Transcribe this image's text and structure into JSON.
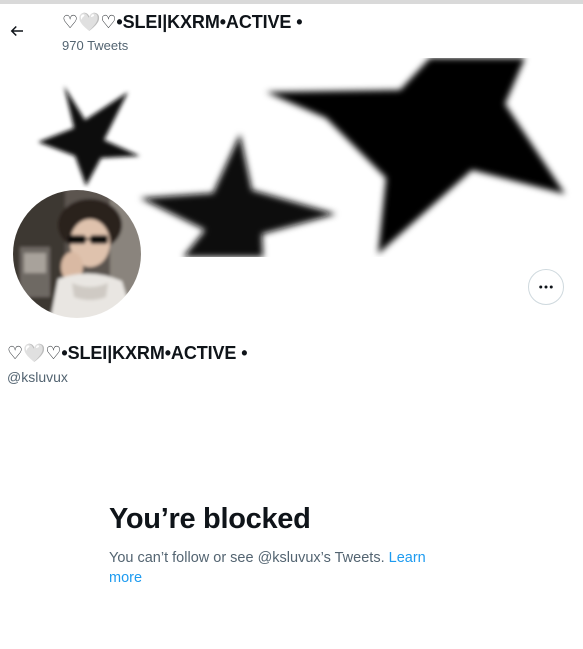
{
  "header": {
    "back_icon": "arrow-left-icon",
    "title": "♡🤍♡•SLEI|KXRM•ACTIVE •",
    "tweet_count": "970 Tweets"
  },
  "banner": {
    "image": "black-stars-banner"
  },
  "profile": {
    "avatar": "profile-photo",
    "display_name": "♡🤍♡•SLEI|KXRM•ACTIVE •",
    "handle": "@ksluvux",
    "more_icon": "more-dots-icon"
  },
  "blocked": {
    "title": "You’re blocked",
    "message": "You can’t follow or see @ksluvux’s Tweets.",
    "learn_more": "Learn more"
  },
  "colors": {
    "text_primary": "#0f1419",
    "text_secondary": "#536471",
    "link": "#1d9bf0",
    "border": "#cfd9de"
  }
}
